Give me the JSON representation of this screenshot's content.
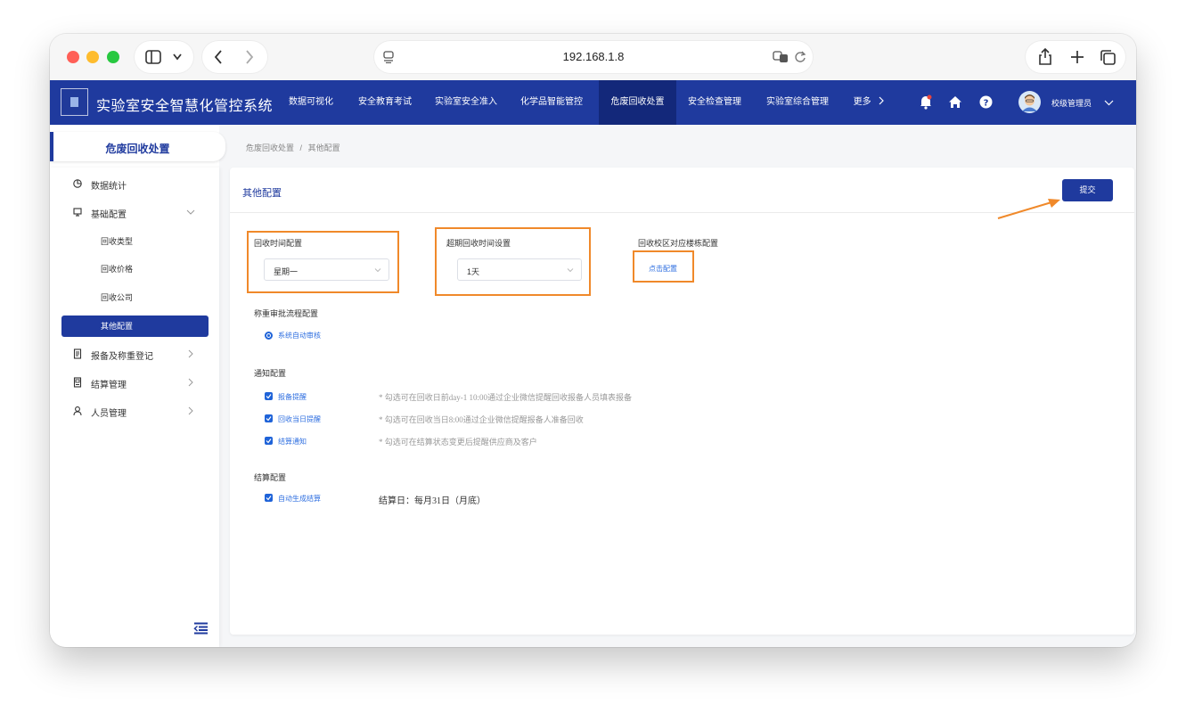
{
  "browser": {
    "url": "192.168.1.8"
  },
  "header": {
    "app_title": "实验室安全智慧化管控系统",
    "nav": [
      {
        "label": "数据可视化"
      },
      {
        "label": "安全教育考试"
      },
      {
        "label": "实验室安全准入"
      },
      {
        "label": "化学品智能管控"
      },
      {
        "label": "危废回收处置"
      },
      {
        "label": "安全检查管理"
      },
      {
        "label": "实验室综合管理"
      },
      {
        "label": "更多"
      }
    ],
    "active_nav": "危废回收处置",
    "user_name": "校级管理员"
  },
  "sidebar": {
    "title": "危废回收处置",
    "items": [
      {
        "label": "数据统计",
        "icon": "pie-chart-icon"
      },
      {
        "label": "基础配置",
        "icon": "monitor-icon"
      },
      {
        "label": "回收类型"
      },
      {
        "label": "回收价格"
      },
      {
        "label": "回收公司"
      },
      {
        "label": "其他配置"
      },
      {
        "label": "报备及称重登记",
        "icon": "document-icon"
      },
      {
        "label": "结算管理",
        "icon": "ledger-icon"
      },
      {
        "label": "人员管理",
        "icon": "user-icon"
      }
    ],
    "active_item": "其他配置"
  },
  "breadcrumb": {
    "parent": "危废回收处置",
    "separator": "/",
    "current": "其他配置"
  },
  "panel": {
    "title": "其他配置",
    "submit_label": "提交",
    "recycle_time": {
      "label": "回收时间配置",
      "value": "星期一"
    },
    "overdue_time": {
      "label": "超期回收时间设置",
      "value": "1天"
    },
    "campus_building": {
      "label": "回收校区对应楼栋配置",
      "link": "点击配置"
    },
    "weighing_approval": {
      "label": "称重审批流程配置",
      "option": "系统自动审核"
    },
    "notify": {
      "label": "通知配置",
      "options": [
        {
          "label": "报备提醒",
          "hint": "* 勾选可在回收日前day-1 10:00通过企业微信提醒回收报备人员填表报备"
        },
        {
          "label": "回收当日提醒",
          "hint": "* 勾选可在回收当日8:00通过企业微信提醒报备人准备回收"
        },
        {
          "label": "结算通知",
          "hint": "* 勾选可在结算状态变更后提醒供应商及客户"
        }
      ]
    },
    "settlement": {
      "label": "结算配置",
      "option": "自动生成结算",
      "day_text": "结算日：每月31日（月底）"
    }
  },
  "colors": {
    "primary": "#1f3a9e",
    "highlight": "#f0892a",
    "link": "#2f6fe0"
  }
}
